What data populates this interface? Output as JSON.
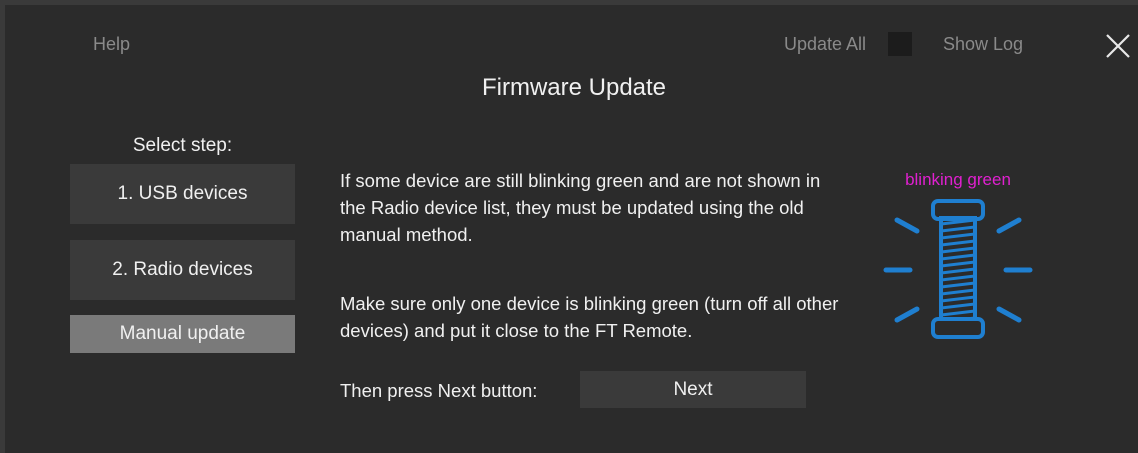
{
  "header": {
    "help_label": "Help",
    "update_all_label": "Update All",
    "show_log_label": "Show Log",
    "title": "Firmware Update"
  },
  "sidebar": {
    "select_label": "Select step:",
    "steps": [
      {
        "label": "1. USB devices"
      },
      {
        "label": "2. Radio devices"
      },
      {
        "label": "Manual update",
        "selected": true
      }
    ]
  },
  "main": {
    "paragraph1": "If some device are still blinking green and are not shown in the Radio device list, they must be updated using the old manual method.",
    "paragraph2": "Make sure only one device is blinking green (turn off all other devices) and put it close to the FT Remote.",
    "then_label": "Then press Next button:",
    "next_label": "Next"
  },
  "illustration": {
    "label": "blinking green",
    "label_color": "#e020d0",
    "device_color": "#1f7fd0",
    "icon": "blinking-device-icon"
  },
  "colors": {
    "background": "#2b2b2b",
    "button": "#3a3a3a",
    "selected_button": "#7a7a7a"
  }
}
